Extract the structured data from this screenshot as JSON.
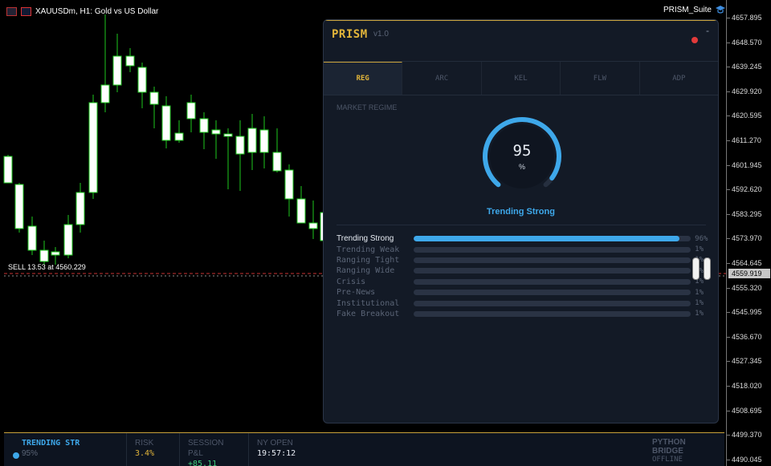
{
  "chart": {
    "symbol_line": "XAUUSDm, H1:  Gold vs US Dollar",
    "suite_name": "PRISM_Suite",
    "sell_line": "SELL 13.53 at 4560.229",
    "current_price": "4559.919",
    "price_levels": [
      "4657.895",
      "4648.570",
      "4639.245",
      "4629.920",
      "4620.595",
      "4611.270",
      "4601.945",
      "4592.620",
      "4583.295",
      "4573.970",
      "4564.645",
      "4555.320",
      "4545.995",
      "4536.670",
      "4527.345",
      "4518.020",
      "4508.695",
      "4499.370",
      "4490.045"
    ],
    "colors": {
      "bull": "#ffffff",
      "bear": "#ffffff",
      "wick": "#1ec81e",
      "line": "#c83232"
    }
  },
  "panel": {
    "brand": "PRISM",
    "version": "v1.0",
    "minimize": "-",
    "tabs": [
      "REG",
      "ARC",
      "KEL",
      "FLW",
      "ADP"
    ],
    "active_tab": 0,
    "section_title": "MARKET REGIME",
    "gauge": {
      "value": "95",
      "unit": "%",
      "fraction": 0.95,
      "color": "#3ea8ea"
    },
    "regime_name": "Trending Strong",
    "regimes": [
      {
        "label": "Trending Strong",
        "pct": "96%",
        "value": 96
      },
      {
        "label": "Trending Weak",
        "pct": "1%",
        "value": 1
      },
      {
        "label": "Ranging Tight",
        "pct": "1%",
        "value": 1
      },
      {
        "label": "Ranging Wide",
        "pct": "1%",
        "value": 1
      },
      {
        "label": "Crisis",
        "pct": "1%",
        "value": 1
      },
      {
        "label": "Pre-News",
        "pct": "1%",
        "value": 1
      },
      {
        "label": "Institutional",
        "pct": "1%",
        "value": 1
      },
      {
        "label": "Fake Breakout",
        "pct": "1%",
        "value": 1
      }
    ]
  },
  "status_bar": {
    "regime_label": "TRENDING STR",
    "regime_pct": "95%",
    "risk_label": "RISK",
    "risk_value": "3.4%",
    "pnl_label": "SESSION P&L",
    "pnl_value": "+85.11",
    "session_label": "NY OPEN",
    "session_value": "19:57:12",
    "bridge_label": "PYTHON BRIDGE",
    "bridge_value": "OFFLINE"
  }
}
